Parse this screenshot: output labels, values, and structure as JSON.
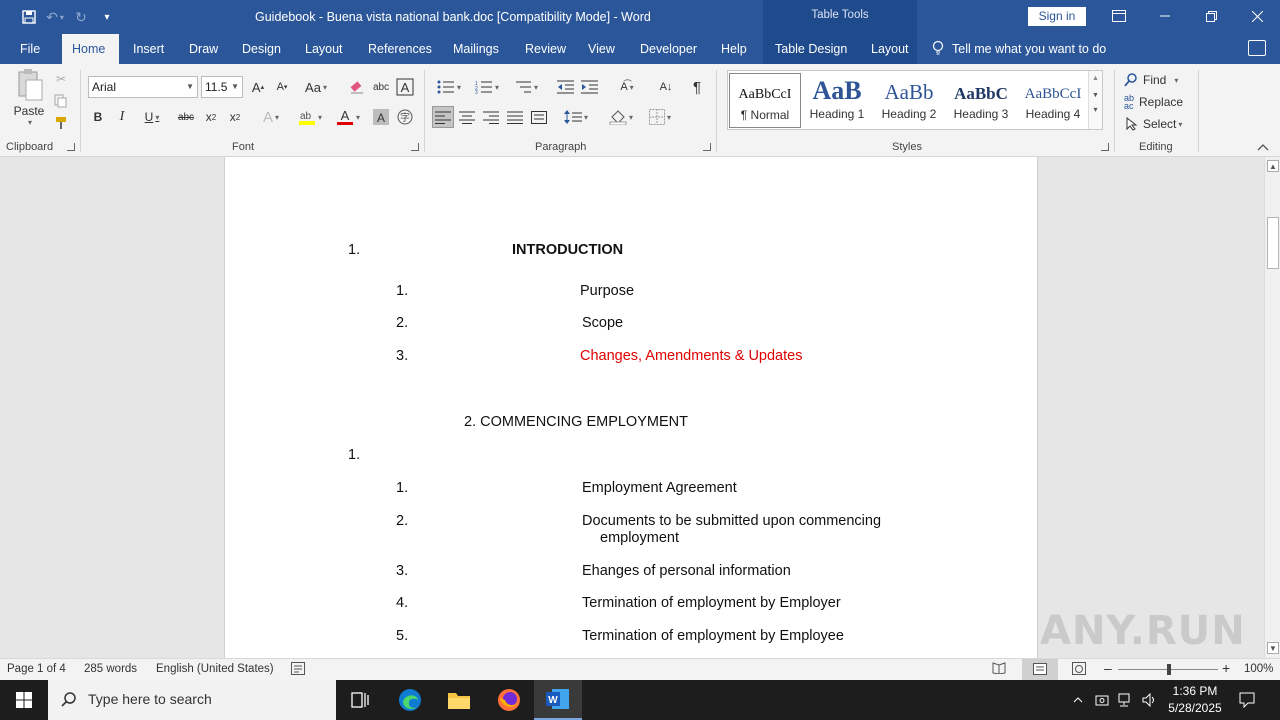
{
  "window": {
    "title": "Guidebook - Buena vista national bank.doc [Compatibility Mode]  -  Word",
    "context_tab_group": "Table Tools",
    "sign_in": "Sign in"
  },
  "ribbon_tabs": [
    {
      "label": "File"
    },
    {
      "label": "Home"
    },
    {
      "label": "Insert"
    },
    {
      "label": "Draw"
    },
    {
      "label": "Design"
    },
    {
      "label": "Layout"
    },
    {
      "label": "References"
    },
    {
      "label": "Mailings"
    },
    {
      "label": "Review"
    },
    {
      "label": "View"
    },
    {
      "label": "Developer"
    },
    {
      "label": "Help"
    },
    {
      "label": "Table Design"
    },
    {
      "label": "Layout"
    }
  ],
  "tell_me": "Tell me what you want to do",
  "clipboard": {
    "paste_label": "Paste",
    "group_label": "Clipboard"
  },
  "font": {
    "name": "Arial",
    "size": "11.5",
    "group_label": "Font",
    "case_label": "Aa"
  },
  "paragraph": {
    "group_label": "Paragraph"
  },
  "styles": {
    "group_label": "Styles",
    "items": [
      {
        "sample": "AaBbCcI",
        "name": "¶ Normal"
      },
      {
        "sample": "AaB",
        "name": "Heading 1"
      },
      {
        "sample": "AaBb",
        "name": "Heading 2"
      },
      {
        "sample": "AaBbC",
        "name": "Heading 3"
      },
      {
        "sample": "AaBbCcI",
        "name": "Heading 4"
      }
    ]
  },
  "editing": {
    "find": "Find",
    "replace": "Replace",
    "select": "Select",
    "group_label": "Editing"
  },
  "document": {
    "lines": [
      {
        "num": "1.",
        "text": "INTRODUCTION"
      },
      {
        "num": "1.",
        "text": "Purpose"
      },
      {
        "num": "2.",
        "text": "Scope"
      },
      {
        "num": "3.",
        "text": "Changes,  Amendments  & Updates"
      },
      {
        "num": "",
        "text": "2. COMMENCING EMPLOYMENT"
      },
      {
        "num": "1.",
        "text": ""
      },
      {
        "num": "1.",
        "text": "Employment  Agreement"
      },
      {
        "num": "2.",
        "text": "Documents to be submitted  upon commencing"
      },
      {
        "num": "",
        "text": "employment"
      },
      {
        "num": "3.",
        "text": "Ehanges  of personal  information"
      },
      {
        "num": "4.",
        "text": "Termination  of employment  by Employer"
      },
      {
        "num": "5.",
        "text": "Termination  of employment  by Employee"
      }
    ]
  },
  "status": {
    "page": "Page 1 of 4",
    "words": "285 words",
    "language": "English (United States)",
    "zoom": "100%"
  },
  "taskbar": {
    "search_placeholder": "Type here to search",
    "time": "1:36 PM",
    "date": "5/28/2025"
  },
  "watermark": "ANY.RUN"
}
